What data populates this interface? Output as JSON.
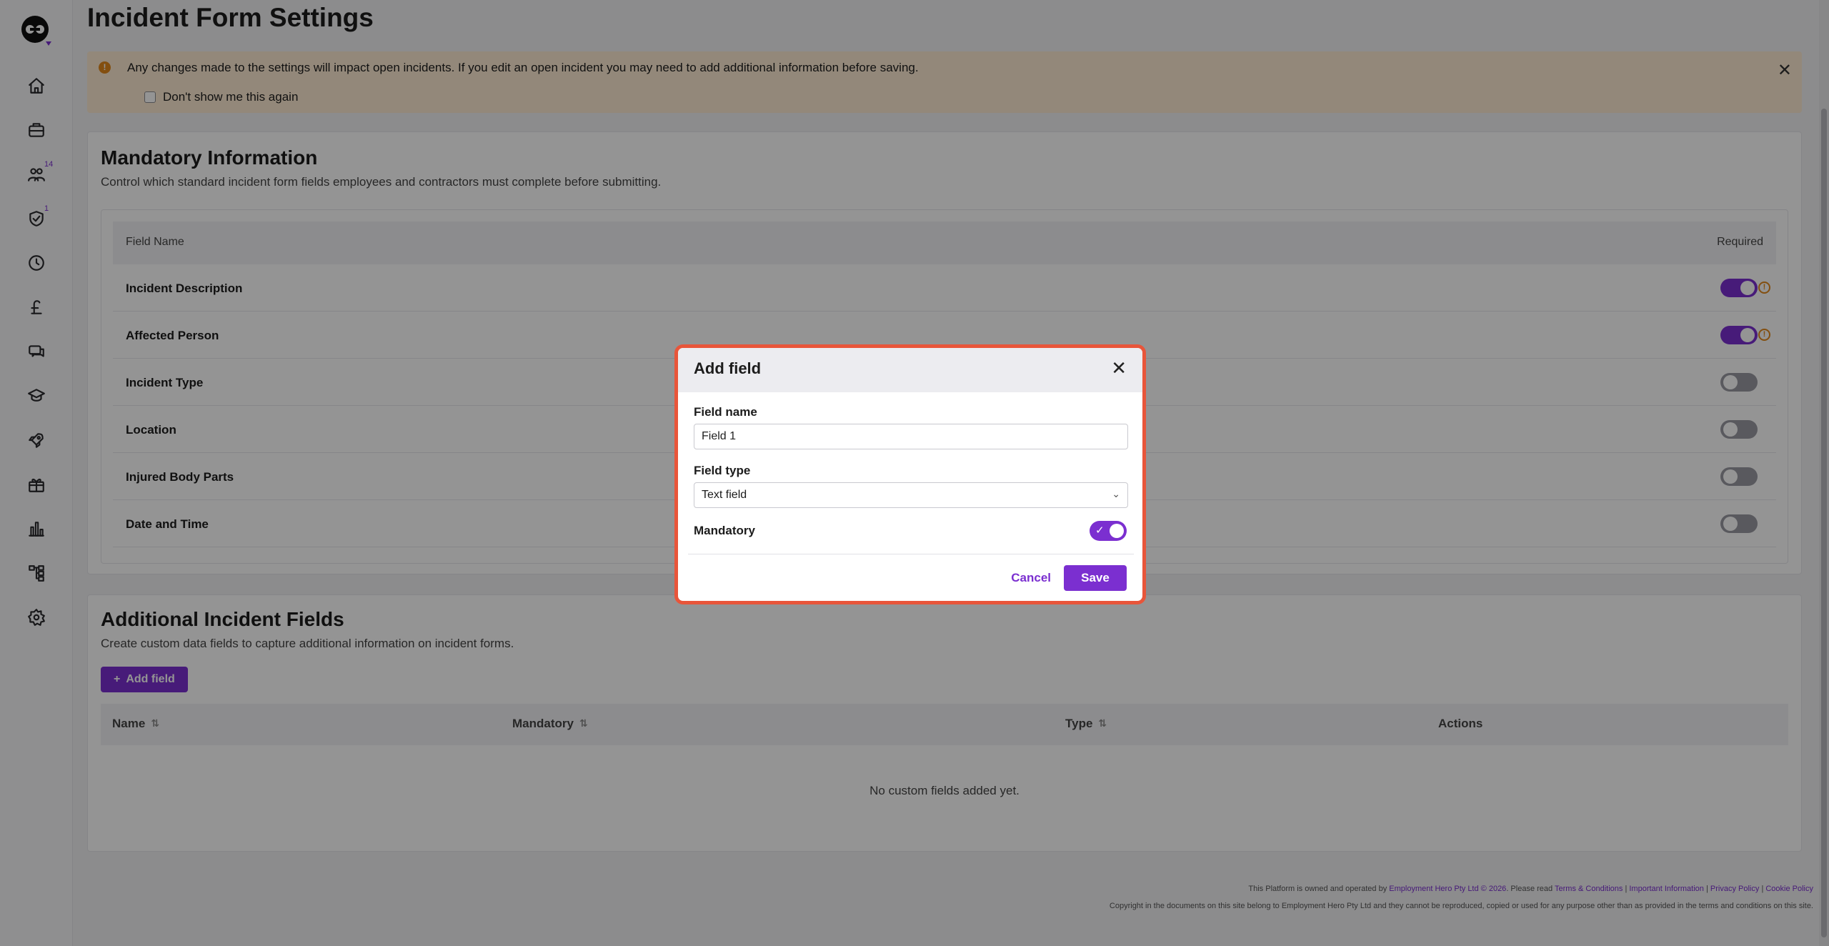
{
  "page": {
    "title": "Incident Form Settings"
  },
  "colors": {
    "accent": "#7b2fd0",
    "warning": "#e2891d",
    "banner_bg": "#fdebd2",
    "modal_border": "#e8553a"
  },
  "sidebar": {
    "items": [
      {
        "icon": "home-icon"
      },
      {
        "icon": "briefcase-icon"
      },
      {
        "icon": "people-icon",
        "badge": "14"
      },
      {
        "icon": "shield-check-icon",
        "badge": "1"
      },
      {
        "icon": "clock-icon"
      },
      {
        "icon": "pound-icon"
      },
      {
        "icon": "chat-icon"
      },
      {
        "icon": "graduation-cap-icon"
      },
      {
        "icon": "rocket-icon"
      },
      {
        "icon": "gift-icon"
      },
      {
        "icon": "bar-chart-icon"
      },
      {
        "icon": "org-chart-icon"
      },
      {
        "icon": "gear-icon"
      }
    ]
  },
  "banner": {
    "icon": "warning-icon",
    "text": "Any changes made to the settings will impact open incidents. If you edit an open incident you may need to add additional information before saving.",
    "checkbox_label": "Don't show me this again",
    "close_icon": "close-icon"
  },
  "mandatory": {
    "title": "Mandatory Information",
    "subtitle": "Control which standard incident form fields employees and contractors must complete before submitting.",
    "col_field_name": "Field Name",
    "col_required": "Required",
    "rows": [
      {
        "name": "Incident Description",
        "required": true,
        "warning": true
      },
      {
        "name": "Affected Person",
        "required": true,
        "warning": true
      },
      {
        "name": "Incident Type",
        "required": false,
        "warning": false
      },
      {
        "name": "Location",
        "required": false,
        "warning": false
      },
      {
        "name": "Injured Body Parts",
        "required": false,
        "warning": false
      },
      {
        "name": "Date and Time",
        "required": false,
        "warning": false
      }
    ]
  },
  "additional": {
    "title": "Additional Incident Fields",
    "subtitle": "Create custom data fields to capture additional information on incident forms.",
    "add_button": "Add field",
    "columns": {
      "name": "Name",
      "mandatory": "Mandatory",
      "type": "Type",
      "actions": "Actions"
    },
    "empty": "No custom fields added yet."
  },
  "footer": {
    "line1_prefix": "This Platform is owned and operated by",
    "line1_company": "Employment Hero Pty Ltd © 2026",
    "line1_mid": ". Please read",
    "link_terms": "Terms & Conditions",
    "link_important": "Important Information",
    "link_privacy": "Privacy Policy",
    "link_cookie": "Cookie Policy",
    "sep": "|",
    "line2": "Copyright in the documents on this site belong to Employment Hero Pty Ltd and they cannot be reproduced, copied or used for any purpose other than as provided in the terms and conditions on this site."
  },
  "modal": {
    "title": "Add field",
    "field_name_label": "Field name",
    "field_name_value": "Field 1",
    "field_type_label": "Field type",
    "field_type_value": "Text field",
    "mandatory_label": "Mandatory",
    "mandatory_on": true,
    "cancel": "Cancel",
    "save": "Save"
  }
}
